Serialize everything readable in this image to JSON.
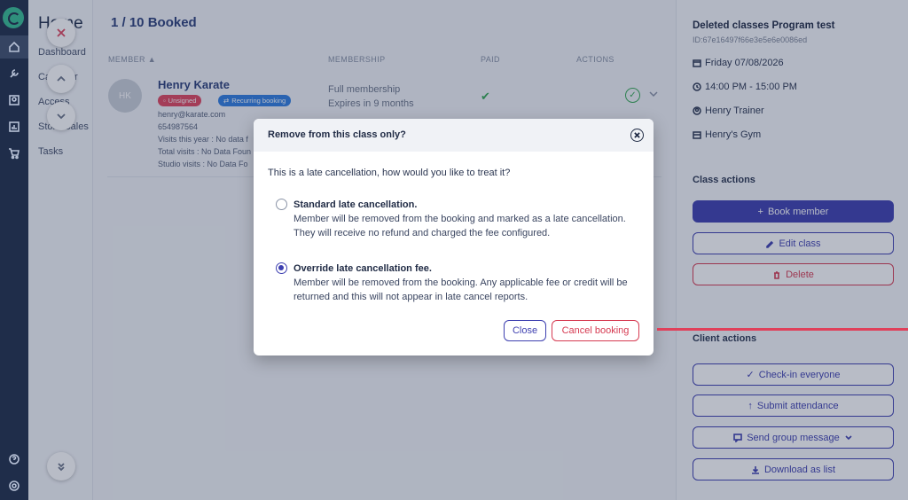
{
  "nav": {
    "brand": "Home",
    "items": [
      "Dashboard",
      "Calendar",
      "Access",
      "Store Sales",
      "Tasks"
    ]
  },
  "main": {
    "booked": "1 / 10 Booked",
    "headers": {
      "member": "MEMBER",
      "membership": "MEMBERSHIP",
      "paid": "PAID",
      "actions": "ACTIONS"
    },
    "row": {
      "initials": "HK",
      "name": "Henry Karate",
      "badge_unsigned": "Unsigned",
      "badge_recurring": "Recurring booking",
      "email": "henry@karate.com",
      "phone": "654987564",
      "visits_year": "Visits this year : No data f",
      "total_visits": "Total visits : No Data Foun",
      "studio_visits": "Studio visits : No Data Fo",
      "membership_name": "Full membership",
      "membership_expiry": "Expires in 9 months"
    }
  },
  "panel": {
    "title": "Deleted classes Program test",
    "id": "ID:67e16497f66e3e5e6e0086ed",
    "date": "Friday 07/08/2026",
    "time": "14:00 PM - 15:00 PM",
    "trainer": "Henry Trainer",
    "location": "Henry's Gym",
    "class_actions_heading": "Class actions",
    "book_member": "Book member",
    "edit_class": "Edit class",
    "delete": "Delete",
    "client_actions_heading": "Client actions",
    "check_in": "Check-in everyone",
    "submit_attendance": "Submit attendance",
    "send_group_message": "Send group message",
    "download_list": "Download as list"
  },
  "modal": {
    "title": "Remove from this class only?",
    "prompt": "This is a late cancellation, how would you like to treat it?",
    "option1_title": "Standard late cancellation.",
    "option1_desc": "Member will be removed from the booking and marked as a late cancellation. They will receive no refund and charged the fee configured.",
    "option2_title": "Override late cancellation fee.",
    "option2_desc": "Member will be removed from the booking. Any applicable fee or credit will be returned and this will not appear in late cancel reports.",
    "selected_option": 2,
    "close": "Close",
    "cancel_booking": "Cancel booking"
  },
  "colors": {
    "primary": "#3d3fb0",
    "danger": "#d63a51",
    "success": "#34a853",
    "sidebar": "#1f2d4a"
  }
}
